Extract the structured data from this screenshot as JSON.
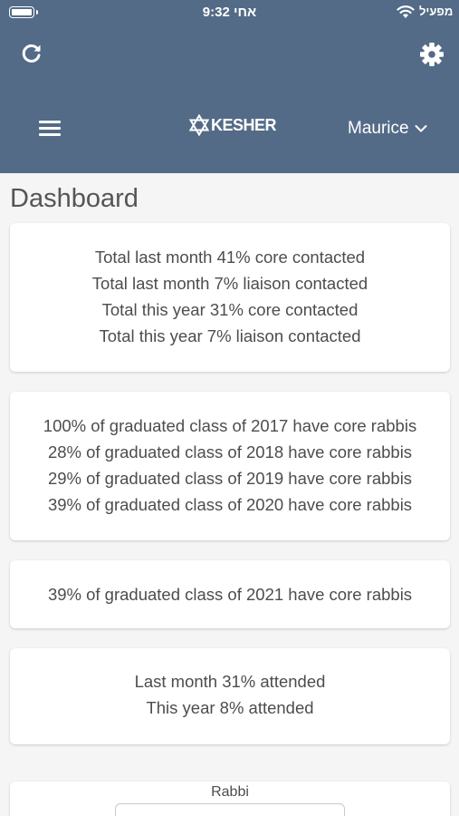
{
  "status_bar": {
    "time": "9:32 אחי",
    "carrier": "מפעיל"
  },
  "header": {
    "logo_text": "KESHER",
    "user_name": "Maurice",
    "icons": [
      "refresh-icon",
      "gear-icon",
      "menu-icon",
      "chevron-down-icon",
      "star-of-david-icon"
    ],
    "background": "#536b87"
  },
  "page": {
    "title": "Dashboard"
  },
  "cards": [
    {
      "lines": [
        "Total last month 41% core contacted",
        "Total last month 7% liaison contacted",
        "Total this year 31% core contacted",
        "Total this year 7% liaison contacted"
      ]
    },
    {
      "lines": [
        "100% of graduated class of 2017 have core rabbis",
        "28% of graduated class of 2018 have core rabbis",
        "29% of graduated class of 2019 have core rabbis",
        "39% of graduated class of 2020 have core rabbis"
      ]
    },
    {
      "lines": [
        "39% of graduated class of 2021 have core rabbis"
      ]
    },
    {
      "lines": [
        "Last month 31% attended",
        "This year 8% attended"
      ]
    }
  ],
  "filter": {
    "label": "Rabbi"
  }
}
